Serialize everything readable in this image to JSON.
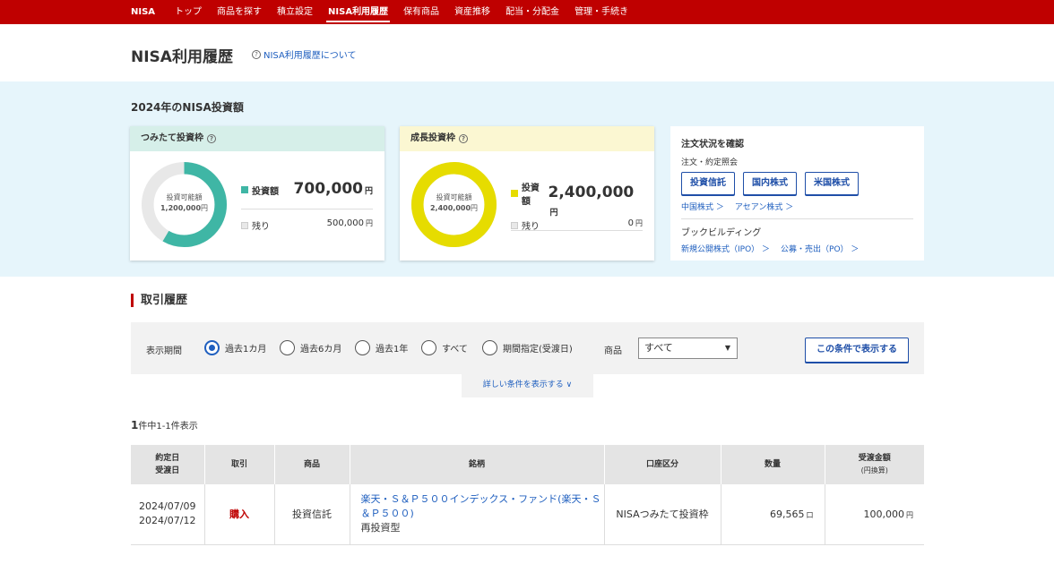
{
  "nav": {
    "brand": "NISA",
    "items": [
      "トップ",
      "商品を探す",
      "積立設定",
      "NISA利用履歴",
      "保有商品",
      "資産推移",
      "配当・分配金",
      "管理・手続き"
    ],
    "active_index": 3
  },
  "header": {
    "title": "NISA利用履歴",
    "about_link": "NISA利用履歴について"
  },
  "summary": {
    "title": "2024年のNISA投資額",
    "tsumitate": {
      "label": "つみたて投資枠",
      "available_label": "投資可能額",
      "available_value": "1,200,000",
      "invested_label": "投資額",
      "invested_value": "700,000",
      "remaining_label": "残り",
      "remaining_value": "500,000",
      "unit": "円",
      "used_fraction": 0.5833,
      "color": "#3fb6a5"
    },
    "seicho": {
      "label": "成長投資枠",
      "available_label": "投資可能額",
      "available_value": "2,400,000",
      "invested_label": "投資額",
      "invested_value": "2,400,000",
      "remaining_label": "残り",
      "remaining_value": "0",
      "unit": "円",
      "used_fraction": 1.0,
      "color": "#e6dc00"
    }
  },
  "orders": {
    "title": "注文状況を確認",
    "subtitle": "注文・約定照会",
    "buttons": [
      "投資信託",
      "国内株式",
      "米国株式"
    ],
    "links": [
      "中国株式 ＞",
      "アセアン株式 ＞"
    ],
    "bb_title": "ブックビルディング",
    "bb_links": [
      "新規公開株式（IPO） ＞",
      "公募・売出（PO） ＞"
    ]
  },
  "history": {
    "title": "取引履歴",
    "period_label": "表示期間",
    "periods": [
      "過去1カ月",
      "過去6カ月",
      "過去1年",
      "すべて",
      "期間指定(受渡日)"
    ],
    "product_label": "商品",
    "product_value": "すべて",
    "apply_label": "この条件で表示する",
    "more_label": "詳しい条件を表示する ∨",
    "count_num": "1",
    "count_text": "件中1-1件表示",
    "columns": {
      "date1": "約定日",
      "date2": "受渡日",
      "trade": "取引",
      "product": "商品",
      "name": "銘柄",
      "account": "口座区分",
      "qty": "数量",
      "amount": "受渡金額",
      "amount_sub": "(円換算)"
    },
    "rows": [
      {
        "trade_date": "2024/07/09",
        "settle_date": "2024/07/12",
        "trade": "購入",
        "product": "投資信託",
        "name": "楽天・Ｓ＆Ｐ５００インデックス・ファンド(楽天・Ｓ＆Ｐ５００)",
        "reinvest": "再投資型",
        "account": "NISAつみたて投資枠",
        "qty": "69,565",
        "qty_unit": "口",
        "amount": "100,000",
        "amount_unit": "円"
      }
    ]
  }
}
